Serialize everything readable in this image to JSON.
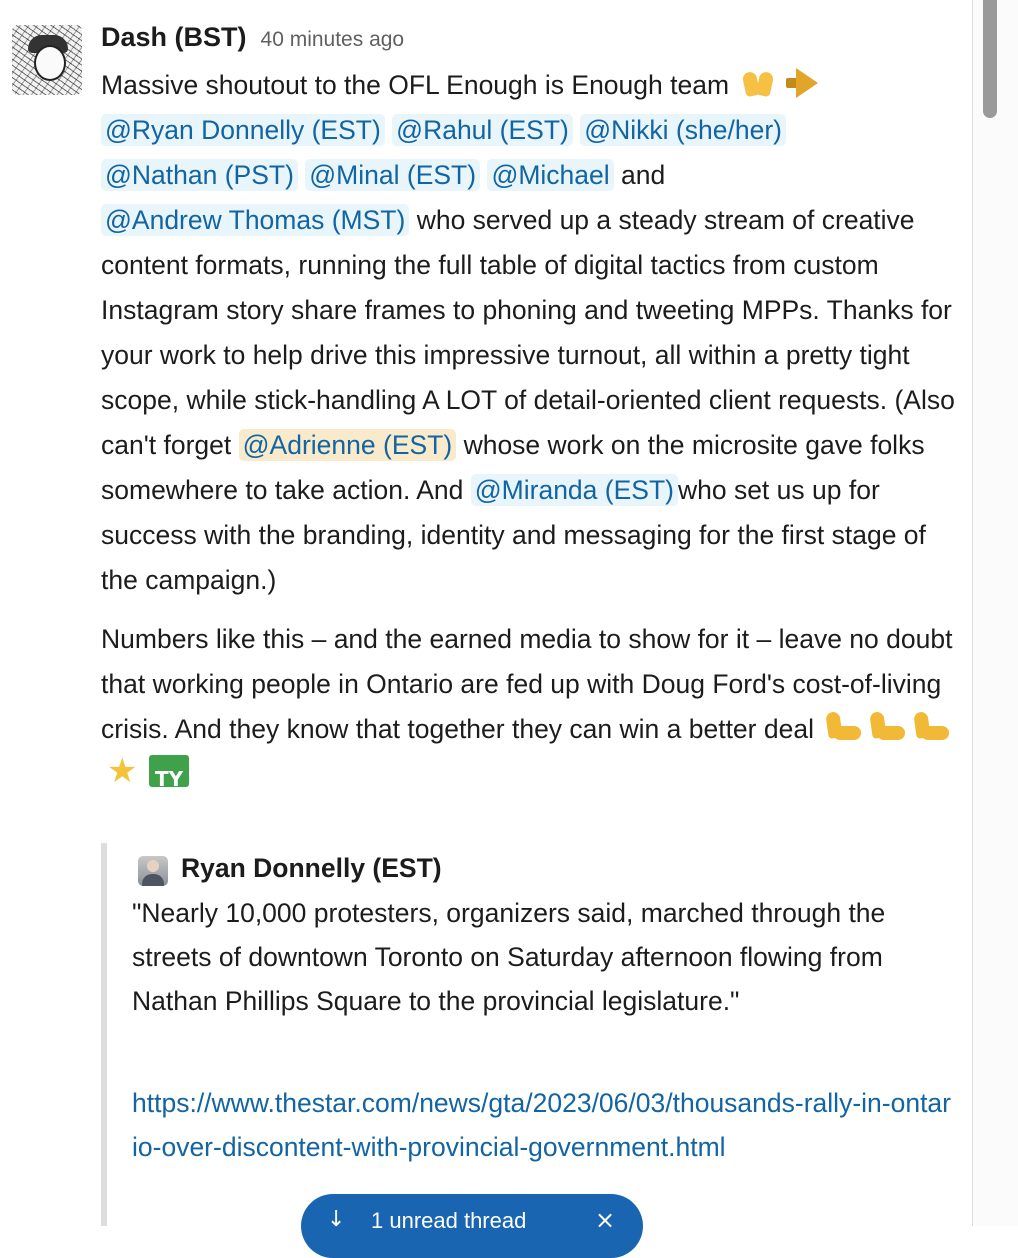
{
  "message": {
    "sender": "Dash (BST)",
    "timestamp": "40 minutes ago",
    "p1": {
      "intro": "Massive shoutout to the OFL Enough is Enough team",
      "mentions_row1": [
        "@Ryan Donnelly (EST)",
        "@Rahul (EST)",
        "@Nikki (she/her)"
      ],
      "mentions_row2": [
        "@Nathan (PST)",
        "@Minal (EST)",
        "@Michael"
      ],
      "and": "and",
      "mention_andrew": "@Andrew Thomas (MST)",
      "text_a": "who served up a steady stream of creative content formats, running the full table of digital tactics from custom Instagram story share frames to phoning and tweeting MPPs. Thanks for your work to help drive this impressive turnout, all within a pretty tight scope, while stick-handling A LOT of detail-oriented client requests. (Also can't forget",
      "mention_adrienne": "@Adrienne (EST)",
      "text_b": "whose work on the microsite gave folks somewhere to take action. And",
      "mention_miranda": "@Miranda (EST)",
      "text_c": "who set us up for success with the branding, identity and messaging for the first stage of the campaign.)"
    },
    "p2": "Numbers like this – and the earned media to show for it – leave no doubt that working people in Ontario are fed up with Doug Ford's cost-of-living crisis. And they know that together they can win a better deal",
    "emojis_p1": [
      "raised-hands",
      "megaphone"
    ],
    "emojis_p2": [
      "flexed-biceps",
      "flexed-biceps",
      "flexed-biceps",
      "glowing-star",
      "ty"
    ]
  },
  "quote": {
    "author": "Ryan Donnelly (EST)",
    "text": "\"Nearly 10,000 protesters, organizers said, marched through the streets of downtown Toronto on Saturday afternoon flowing from Nathan Phillips Square to the provincial legislature.\"",
    "link": "https://www.thestar.com/news/gta/2023/06/03/thousands-rally-in-ontario-over-discontent-with-provincial-government.html"
  },
  "unread_pill": {
    "label": "1 unread thread",
    "arrow": "↓",
    "close": "×"
  }
}
